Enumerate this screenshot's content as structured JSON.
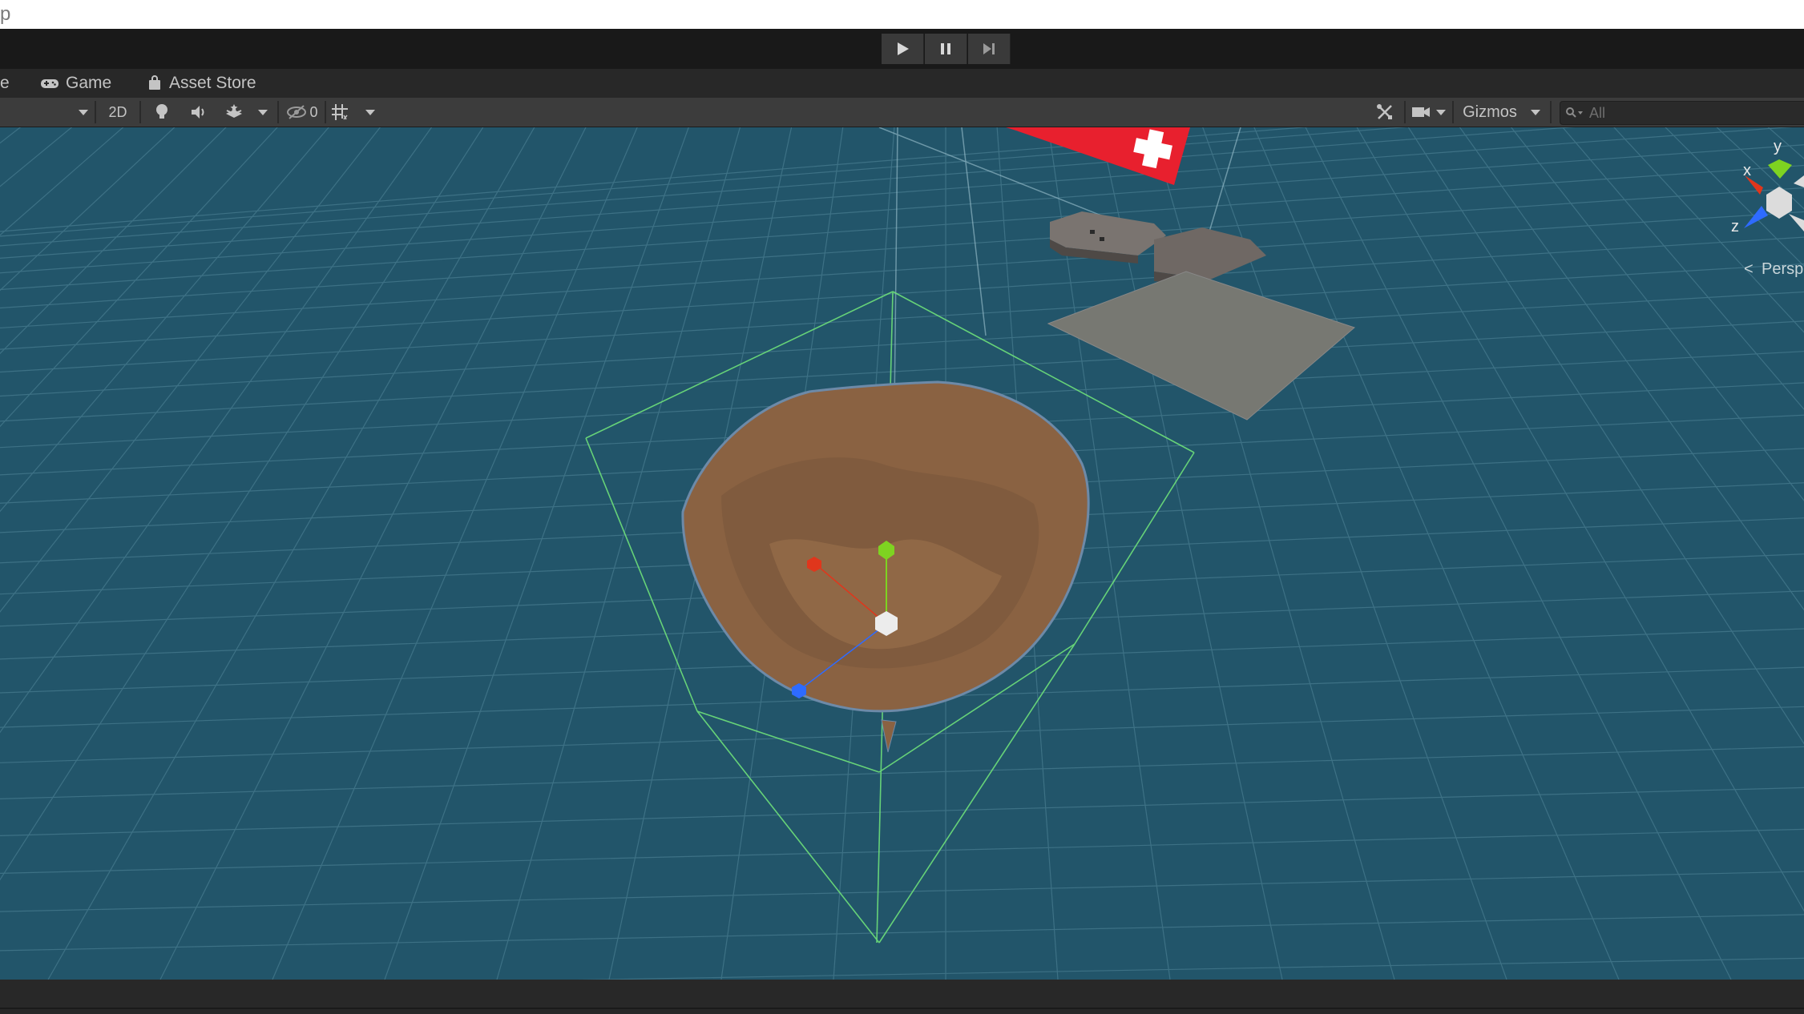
{
  "menubar": {
    "text": "p"
  },
  "playbar": {
    "play_icon": "play-icon",
    "pause_icon": "pause-icon",
    "step_icon": "step-icon"
  },
  "tabs": [
    {
      "label": "e",
      "icon": ""
    },
    {
      "label": "Game",
      "icon": "gamepad-icon"
    },
    {
      "label": "Asset Store",
      "icon": "shopping-bag-icon"
    }
  ],
  "toolbar": {
    "mode_2d_label": "2D",
    "hidden_count": "0",
    "gizmos_label": "Gizmos",
    "search_placeholder": "All"
  },
  "scene": {
    "orientation_gizmo": {
      "y_label": "y",
      "x_label": "x",
      "z_label": "z"
    },
    "projection_label": "Persp"
  },
  "colors": {
    "viewport_bg": "#22556a",
    "terrain": "#8a6242",
    "bounds_outline": "#6ee07a",
    "flag_red": "#e8202e",
    "axis_x": "#e0361c",
    "axis_y": "#7ed321",
    "axis_z": "#2e6bff"
  }
}
